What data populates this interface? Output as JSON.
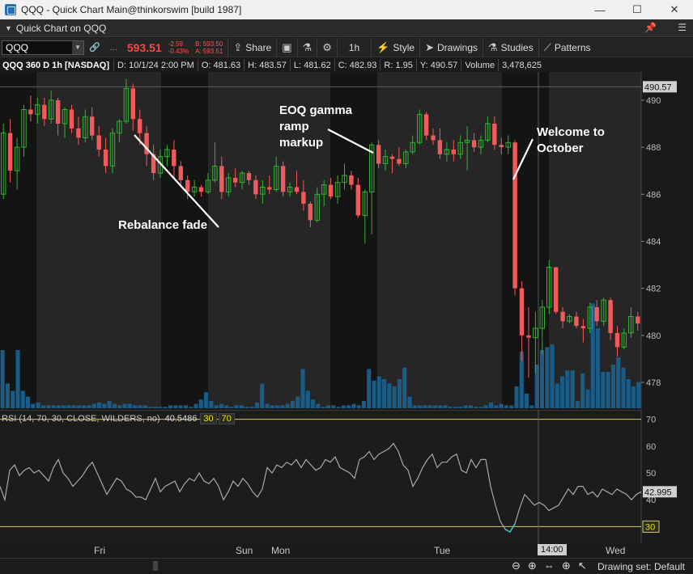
{
  "window": {
    "title": "QQQ - Quick Chart Main@thinkorswim [build 1987]",
    "minimize_glyph": "—",
    "maximize_glyph": "☐",
    "close_glyph": "✕"
  },
  "panel": {
    "title": "Quick Chart on QQQ",
    "pin_glyph": "📌",
    "menu_glyph": "☰"
  },
  "toolbar": {
    "symbol": "QQQ",
    "link_glyph": "🔗",
    "dots": "...",
    "last_price": "593.51",
    "change": "-2.59",
    "change_pct": "-0.43%",
    "bid": "B: 593.50",
    "ask": "A: 593.51",
    "share_label": "Share",
    "timeframe_label": "1h",
    "style_label": "Style",
    "drawings_label": "Drawings",
    "studies_label": "Studies",
    "patterns_label": "Patterns"
  },
  "info": {
    "symbol_desc": "QQQ 360 D 1h [NASDAQ]",
    "date": "D: 10/1/24 2:00 PM",
    "open": "O: 481.63",
    "high": "H: 483.57",
    "low": "L: 481.62",
    "close": "C: 482.93",
    "range": "R: 1.95",
    "y": "Y: 490.57",
    "volume_label": "Volume",
    "volume_value": "3,478,625"
  },
  "price_axis": {
    "ticks": [
      "490",
      "488",
      "486",
      "484",
      "482",
      "480",
      "478"
    ],
    "cursor_label": "490.57"
  },
  "rsi": {
    "label": "RSI (14, 70, 30, CLOSE, WILDERS, no)",
    "value": "40.5486",
    "ob_box": "30",
    "os_box": "70",
    "ticks": [
      "70",
      "60",
      "50",
      "40",
      "30"
    ],
    "current_label": "42.995",
    "level_label": "30"
  },
  "time_axis": {
    "labels": [
      "Fri",
      "Sun",
      "Mon",
      "Tue",
      "Wed"
    ],
    "cursor_label": "14:00"
  },
  "annotations": {
    "rebalance": "Rebalance fade",
    "eoq": "EOQ gamma\nramp\nmarkup",
    "october": "Welcome to\nOctober"
  },
  "status": {
    "drawing_set": "Drawing set: Default"
  },
  "colors": {
    "up": "#2fb52f",
    "down": "#f05a5a",
    "volume": "#1b5c86",
    "rsi_line": "#a8a8a8",
    "rsi_oversold": "#35d0d0",
    "level_line": "#d8c860"
  },
  "chart_data": {
    "type": "candlestick",
    "price_range": [
      476.9,
      491.2
    ],
    "candles": [
      {
        "o": 486.0,
        "h": 489.0,
        "l": 485.8,
        "c": 488.6
      },
      {
        "o": 488.6,
        "h": 489.2,
        "l": 486.5,
        "c": 487.0
      },
      {
        "o": 487.0,
        "h": 488.4,
        "l": 486.2,
        "c": 488.0
      },
      {
        "o": 488.0,
        "h": 489.8,
        "l": 487.6,
        "c": 489.6
      },
      {
        "o": 489.6,
        "h": 490.2,
        "l": 489.1,
        "c": 489.4
      },
      {
        "o": 489.4,
        "h": 490.1,
        "l": 489.0,
        "c": 489.8
      },
      {
        "o": 489.8,
        "h": 490.1,
        "l": 488.9,
        "c": 489.2
      },
      {
        "o": 489.2,
        "h": 490.4,
        "l": 489.0,
        "c": 490.0
      },
      {
        "o": 490.0,
        "h": 490.1,
        "l": 488.5,
        "c": 489.0
      },
      {
        "o": 489.0,
        "h": 489.7,
        "l": 488.4,
        "c": 489.6
      },
      {
        "o": 489.6,
        "h": 489.8,
        "l": 488.6,
        "c": 488.8
      },
      {
        "o": 488.8,
        "h": 489.3,
        "l": 488.1,
        "c": 488.4
      },
      {
        "o": 488.4,
        "h": 489.6,
        "l": 488.2,
        "c": 489.3
      },
      {
        "o": 489.3,
        "h": 489.7,
        "l": 488.3,
        "c": 488.5
      },
      {
        "o": 488.5,
        "h": 488.9,
        "l": 487.6,
        "c": 487.9
      },
      {
        "o": 487.9,
        "h": 488.4,
        "l": 486.9,
        "c": 487.2
      },
      {
        "o": 487.2,
        "h": 488.8,
        "l": 486.9,
        "c": 488.6
      },
      {
        "o": 488.6,
        "h": 489.2,
        "l": 488.2,
        "c": 489.1
      },
      {
        "o": 489.1,
        "h": 490.9,
        "l": 489.0,
        "c": 490.5
      },
      {
        "o": 490.5,
        "h": 490.7,
        "l": 488.7,
        "c": 489.2
      },
      {
        "o": 489.2,
        "h": 489.6,
        "l": 488.1,
        "c": 488.6
      },
      {
        "o": 488.6,
        "h": 488.9,
        "l": 487.2,
        "c": 487.7
      },
      {
        "o": 487.7,
        "h": 488.1,
        "l": 486.6,
        "c": 486.9
      },
      {
        "o": 486.9,
        "h": 487.9,
        "l": 486.7,
        "c": 487.6
      },
      {
        "o": 487.6,
        "h": 488.1,
        "l": 487.2,
        "c": 487.9
      },
      {
        "o": 487.9,
        "h": 488.3,
        "l": 486.7,
        "c": 487.2
      },
      {
        "o": 487.2,
        "h": 487.4,
        "l": 486.3,
        "c": 486.6
      },
      {
        "o": 486.6,
        "h": 486.8,
        "l": 485.8,
        "c": 486.1
      },
      {
        "o": 486.1,
        "h": 486.6,
        "l": 485.9,
        "c": 486.3
      },
      {
        "o": 486.3,
        "h": 486.4,
        "l": 485.9,
        "c": 486.1
      },
      {
        "o": 486.1,
        "h": 486.9,
        "l": 486.0,
        "c": 486.6
      },
      {
        "o": 486.6,
        "h": 488.2,
        "l": 486.5,
        "c": 487.2
      },
      {
        "o": 487.2,
        "h": 487.6,
        "l": 485.8,
        "c": 486.1
      },
      {
        "o": 486.1,
        "h": 486.9,
        "l": 485.9,
        "c": 486.7
      },
      {
        "o": 486.7,
        "h": 487.1,
        "l": 486.3,
        "c": 486.5
      },
      {
        "o": 486.5,
        "h": 487.0,
        "l": 486.2,
        "c": 486.9
      },
      {
        "o": 486.9,
        "h": 487.0,
        "l": 486.4,
        "c": 486.6
      },
      {
        "o": 486.6,
        "h": 486.8,
        "l": 485.8,
        "c": 486.0
      },
      {
        "o": 486.0,
        "h": 486.6,
        "l": 485.6,
        "c": 486.3
      },
      {
        "o": 486.3,
        "h": 486.8,
        "l": 486.0,
        "c": 486.2
      },
      {
        "o": 486.2,
        "h": 487.6,
        "l": 486.1,
        "c": 487.2
      },
      {
        "o": 487.2,
        "h": 487.4,
        "l": 485.9,
        "c": 486.1
      },
      {
        "o": 486.1,
        "h": 486.5,
        "l": 485.9,
        "c": 486.3
      },
      {
        "o": 486.3,
        "h": 487.0,
        "l": 486.0,
        "c": 486.1
      },
      {
        "o": 486.1,
        "h": 486.6,
        "l": 485.3,
        "c": 485.6
      },
      {
        "o": 485.6,
        "h": 485.7,
        "l": 484.6,
        "c": 484.9
      },
      {
        "o": 484.9,
        "h": 486.3,
        "l": 484.8,
        "c": 486.0
      },
      {
        "o": 486.0,
        "h": 486.6,
        "l": 485.5,
        "c": 486.4
      },
      {
        "o": 486.4,
        "h": 486.7,
        "l": 485.8,
        "c": 485.9
      },
      {
        "o": 485.9,
        "h": 486.8,
        "l": 485.6,
        "c": 486.5
      },
      {
        "o": 486.5,
        "h": 487.3,
        "l": 486.2,
        "c": 486.8
      },
      {
        "o": 486.8,
        "h": 487.0,
        "l": 486.2,
        "c": 486.4
      },
      {
        "o": 486.4,
        "h": 486.7,
        "l": 485.0,
        "c": 485.1
      },
      {
        "o": 485.1,
        "h": 486.2,
        "l": 483.9,
        "c": 486.1
      },
      {
        "o": 486.1,
        "h": 488.2,
        "l": 484.3,
        "c": 488.1
      },
      {
        "o": 488.1,
        "h": 488.3,
        "l": 487.1,
        "c": 487.3
      },
      {
        "o": 487.3,
        "h": 487.9,
        "l": 487.0,
        "c": 487.6
      },
      {
        "o": 487.6,
        "h": 487.7,
        "l": 486.9,
        "c": 487.5
      },
      {
        "o": 487.5,
        "h": 488.0,
        "l": 487.2,
        "c": 487.3
      },
      {
        "o": 487.3,
        "h": 487.9,
        "l": 487.1,
        "c": 487.8
      },
      {
        "o": 487.8,
        "h": 488.5,
        "l": 487.7,
        "c": 488.2
      },
      {
        "o": 488.2,
        "h": 489.6,
        "l": 488.1,
        "c": 489.4
      },
      {
        "o": 489.4,
        "h": 489.5,
        "l": 488.3,
        "c": 488.5
      },
      {
        "o": 488.5,
        "h": 488.8,
        "l": 488.1,
        "c": 488.3
      },
      {
        "o": 488.3,
        "h": 488.8,
        "l": 487.5,
        "c": 487.7
      },
      {
        "o": 487.7,
        "h": 488.2,
        "l": 487.4,
        "c": 487.9
      },
      {
        "o": 487.9,
        "h": 488.3,
        "l": 487.4,
        "c": 487.7
      },
      {
        "o": 487.7,
        "h": 488.5,
        "l": 487.5,
        "c": 488.2
      },
      {
        "o": 488.2,
        "h": 488.9,
        "l": 487.0,
        "c": 488.3
      },
      {
        "o": 488.3,
        "h": 488.6,
        "l": 487.8,
        "c": 488.0
      },
      {
        "o": 488.0,
        "h": 488.5,
        "l": 487.7,
        "c": 488.3
      },
      {
        "o": 488.3,
        "h": 489.3,
        "l": 488.2,
        "c": 489.0
      },
      {
        "o": 489.0,
        "h": 489.3,
        "l": 487.9,
        "c": 488.1
      },
      {
        "o": 488.1,
        "h": 488.4,
        "l": 487.7,
        "c": 488.0
      },
      {
        "o": 488.0,
        "h": 488.5,
        "l": 487.7,
        "c": 488.2
      },
      {
        "o": 488.2,
        "h": 488.3,
        "l": 481.7,
        "c": 482.0
      },
      {
        "o": 482.0,
        "h": 482.3,
        "l": 478.9,
        "c": 480.0
      },
      {
        "o": 480.0,
        "h": 481.2,
        "l": 478.2,
        "c": 479.9
      },
      {
        "o": 479.9,
        "h": 481.0,
        "l": 478.4,
        "c": 480.3
      },
      {
        "o": 480.3,
        "h": 481.5,
        "l": 479.2,
        "c": 481.2
      },
      {
        "o": 481.2,
        "h": 483.2,
        "l": 480.9,
        "c": 482.9
      },
      {
        "o": 482.9,
        "h": 482.8,
        "l": 480.9,
        "c": 481.0
      },
      {
        "o": 481.0,
        "h": 481.2,
        "l": 480.3,
        "c": 480.6
      },
      {
        "o": 480.6,
        "h": 480.9,
        "l": 480.5,
        "c": 480.8
      },
      {
        "o": 480.8,
        "h": 481.0,
        "l": 480.3,
        "c": 480.4
      },
      {
        "o": 480.4,
        "h": 480.7,
        "l": 479.7,
        "c": 480.3
      },
      {
        "o": 480.3,
        "h": 481.4,
        "l": 480.1,
        "c": 481.2
      },
      {
        "o": 481.2,
        "h": 481.5,
        "l": 480.4,
        "c": 480.6
      },
      {
        "o": 480.6,
        "h": 481.6,
        "l": 480.4,
        "c": 481.5
      },
      {
        "o": 481.5,
        "h": 481.6,
        "l": 479.8,
        "c": 480.1
      },
      {
        "o": 480.1,
        "h": 480.4,
        "l": 479.1,
        "c": 479.5
      },
      {
        "o": 479.5,
        "h": 480.3,
        "l": 479.4,
        "c": 480.1
      },
      {
        "o": 480.1,
        "h": 481.2,
        "l": 479.9,
        "c": 480.8
      },
      {
        "o": 480.8,
        "h": 481.0,
        "l": 480.2,
        "c": 480.5
      }
    ],
    "volume_relative": [
      0.4,
      0.17,
      0.12,
      0.4,
      0.12,
      0.08,
      0.03,
      0.04,
      0.02,
      0.02,
      0.02,
      0.02,
      0.02,
      0.02,
      0.02,
      0.02,
      0.02,
      0.02,
      0.03,
      0.04,
      0.03,
      0.05,
      0.03,
      0.02,
      0.03,
      0.03,
      0.02,
      0.02,
      0.02,
      0.01,
      0.01,
      0.01,
      0.01,
      0.02,
      0.02,
      0.02,
      0.02,
      0.01,
      0.03,
      0.06,
      0.11,
      0.05,
      0.02,
      0.03,
      0.02,
      0.01,
      0.02,
      0.02,
      0.01,
      0.01,
      0.04,
      0.17,
      0.03,
      0.02,
      0.02,
      0.02,
      0.03,
      0.05,
      0.08,
      0.27,
      0.12,
      0.06,
      0.03,
      0.01,
      0.02,
      0.02,
      0.01,
      0.02,
      0.02,
      0.03,
      0.02,
      0.05,
      0.27,
      0.19,
      0.22,
      0.2,
      0.17,
      0.15,
      0.2,
      0.28,
      0.08,
      0.02,
      0.02,
      0.02,
      0.02,
      0.02,
      0.02,
      0.02,
      0.01,
      0.01,
      0.01,
      0.02,
      0.02,
      0.01,
      0.01,
      0.02,
      0.04,
      0.02,
      0.03,
      0.02,
      0.02,
      0.15,
      0.39,
      0.1,
      0.02,
      0.3,
      0.4,
      0.42,
      0.44,
      0.17,
      0.22,
      0.26,
      0.26,
      0.05,
      0.24,
      0.13,
      0.72,
      0.55,
      0.25,
      0.25,
      0.3,
      0.35,
      0.28,
      0.2,
      0.15,
      0.18
    ],
    "rsi": {
      "range": [
        25,
        72
      ],
      "levels": [
        70,
        30
      ],
      "values": [
        45,
        40,
        51,
        53,
        49,
        51,
        52,
        50,
        51,
        49,
        47,
        52,
        55,
        50,
        48,
        45,
        47,
        49,
        52,
        54,
        50,
        46,
        42,
        45,
        48,
        47,
        44,
        43,
        41,
        41,
        40,
        44,
        48,
        43,
        45,
        46,
        47,
        43,
        46,
        48,
        47,
        50,
        47,
        46,
        48,
        45,
        40,
        43,
        47,
        45,
        48,
        46,
        43,
        41,
        44,
        52,
        50,
        53,
        52,
        54,
        53,
        55,
        52,
        55,
        53,
        51,
        52,
        55,
        54,
        56,
        52,
        51,
        50,
        48,
        55,
        56,
        58,
        55,
        57,
        58,
        59,
        61,
        58,
        53,
        51,
        45,
        48,
        52,
        55,
        57,
        52,
        54,
        54,
        56,
        57,
        51,
        50,
        55,
        52,
        55,
        55,
        45,
        38,
        32,
        29,
        28,
        31,
        37,
        42,
        40,
        38,
        39,
        38,
        36,
        37,
        38,
        41,
        44,
        42,
        45,
        45,
        42,
        43,
        41,
        44,
        43,
        42,
        44,
        43,
        42,
        40,
        42,
        43
      ]
    }
  }
}
